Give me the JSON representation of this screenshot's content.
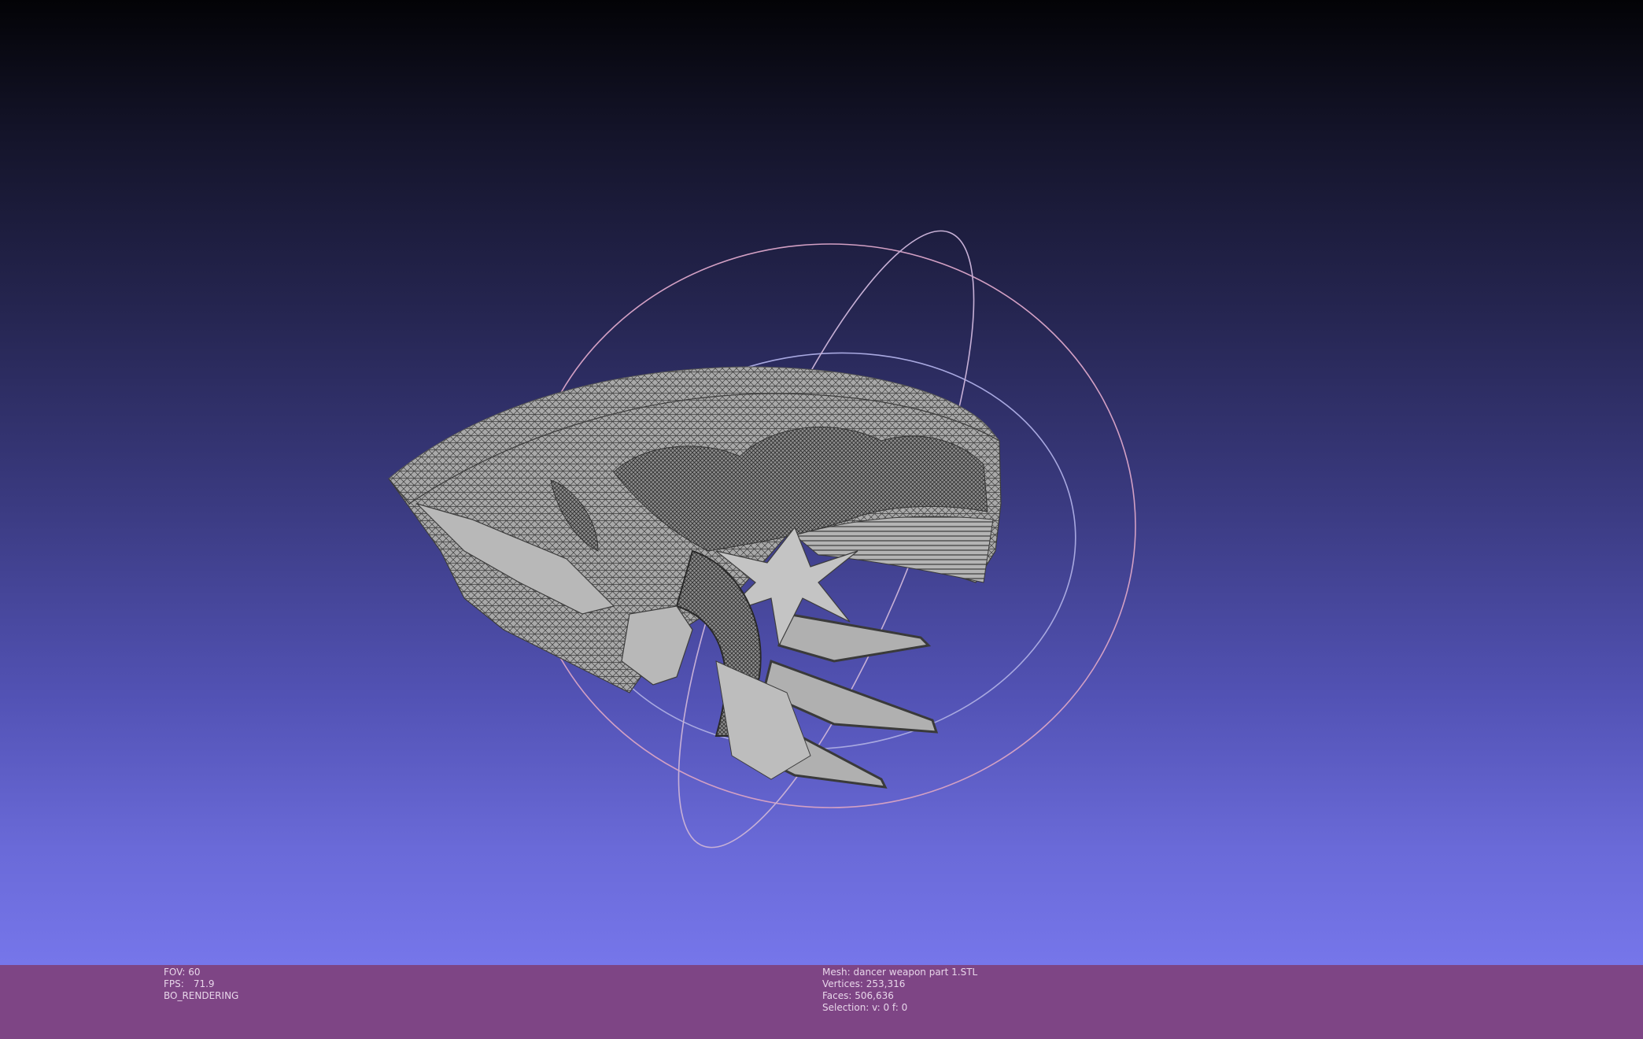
{
  "viewer": {
    "background_top": "#030306",
    "background_bottom": "#7676ea",
    "mesh_fill": "#a9a9a9",
    "mesh_wire": "#3d3d3d",
    "trackball_colors": [
      "#d3a0c4",
      "#a8a8e0",
      "#c7b0d6"
    ]
  },
  "status": {
    "fov_label": "FOV:",
    "fov_value": "60",
    "fps_label": "FPS:",
    "fps_value": "71.9",
    "render_mode": "BO_RENDERING",
    "mesh_label": "Mesh:",
    "mesh_name": "dancer weapon part 1.STL",
    "vertices_label": "Vertices:",
    "vertices_value": "253,316",
    "faces_label": "Faces:",
    "faces_value": "506,636",
    "selection_label": "Selection:",
    "selection_value": "v: 0 f: 0",
    "bar_color": "#7e4585"
  }
}
